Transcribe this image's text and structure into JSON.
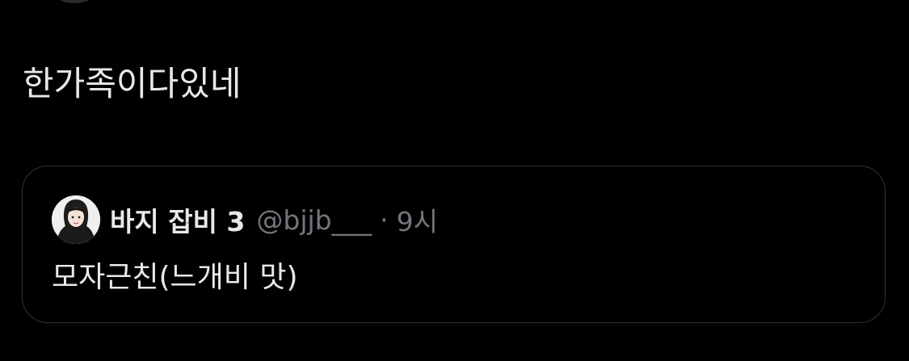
{
  "tweet": {
    "text": "한가족이다있네"
  },
  "quote": {
    "avatar_icon": "user-avatar-icon",
    "display_name": "바지 잡비 3",
    "handle": "@bjjb___",
    "separator": "·",
    "time": "9시",
    "text": "모자근친(느개비 맛)"
  },
  "colors": {
    "background": "#000000",
    "primary_text": "#e7e9ea",
    "secondary_text": "#71767b",
    "border": "#2f3336"
  }
}
